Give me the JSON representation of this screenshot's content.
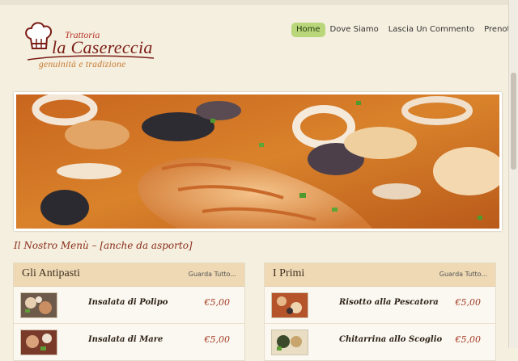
{
  "logo": {
    "small": "Trattoria",
    "name": "la Casereccia",
    "tagline": "genuinità e tradizione"
  },
  "nav": [
    {
      "label": "Home",
      "active": true
    },
    {
      "label": "Dove Siamo"
    },
    {
      "label": "Lascia Un Commento"
    },
    {
      "label": "Prenota"
    }
  ],
  "menu_heading": "Il Nostro Menù – [anche da asporto]",
  "sections": [
    {
      "title": "Gli Antipasti",
      "see_all": "Guarda Tutto...",
      "items": [
        {
          "name": "Insalata di Polipo",
          "price": "€5,00"
        },
        {
          "name": "Insalata di Mare",
          "price": "€5,00"
        }
      ]
    },
    {
      "title": "I Primi",
      "see_all": "Guarda Tutto...",
      "items": [
        {
          "name": "Risotto alla Pescatora",
          "price": "€5,00"
        },
        {
          "name": "Chitarrina allo Scoglio",
          "price": "€5,00"
        }
      ]
    }
  ],
  "colors": {
    "background": "#f5efdf",
    "nav_active": "#b9d77a",
    "card_header": "#eed9b4",
    "price": "#a33a24",
    "brand": "#7b1d16"
  }
}
